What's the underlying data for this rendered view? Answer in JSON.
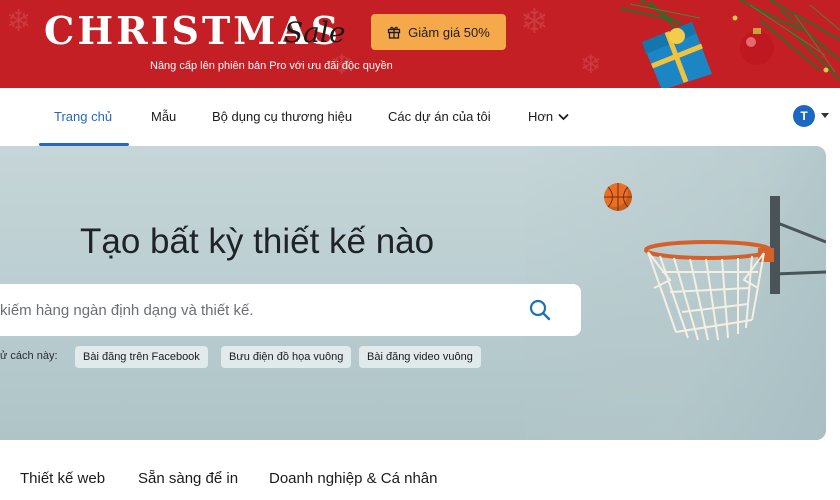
{
  "promo": {
    "title": "CHRISTMAS",
    "script": "Sale",
    "button_label": "Giảm giá 50%",
    "subtitle": "Nâng cấp lên phiên bản Pro với ưu đãi độc quyền",
    "gift_icon": "gift-icon"
  },
  "nav": {
    "items": [
      {
        "label": "Trang chủ"
      },
      {
        "label": "Mẫu"
      },
      {
        "label": "Bộ dụng cụ thương hiệu"
      },
      {
        "label": "Các dự án của tôi"
      },
      {
        "label": "Hơn"
      }
    ],
    "avatar_initial": "T"
  },
  "hero": {
    "title": "Tạo bất kỳ thiết kế nào",
    "search_placeholder": "kiếm hàng ngàn định dạng và thiết kế.",
    "try_label": "ử cách này:",
    "chips": [
      "Bài đăng trên Facebook",
      "Bưu điện đồ họa vuông",
      "Bài đăng video vuông"
    ]
  },
  "categories": [
    "Thiết kế web",
    "Sẵn sàng để in",
    "Doanh nghiệp & Cá nhân"
  ],
  "colors": {
    "promo_bg": "#c41f25",
    "promo_button": "#f6a94a",
    "accent": "#2667c4",
    "hero_bg": "#c6d6d8"
  }
}
